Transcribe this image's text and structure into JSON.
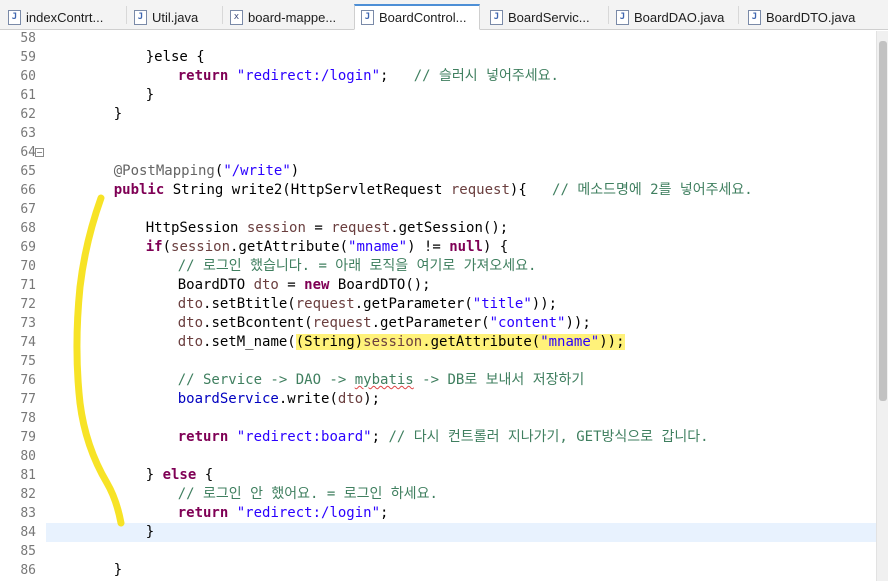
{
  "tabs": [
    {
      "label": "indexContrt...",
      "icon": "java-file-icon"
    },
    {
      "label": "Util.java",
      "icon": "java-file-icon"
    },
    {
      "label": "board-mappe...",
      "icon": "xml-file-icon"
    },
    {
      "label": "BoardControl...",
      "icon": "java-file-icon",
      "active": true
    },
    {
      "label": "BoardServic...",
      "icon": "java-file-icon"
    },
    {
      "label": "BoardDAO.java",
      "icon": "java-file-icon"
    },
    {
      "label": "BoardDTO.java",
      "icon": "java-file-icon"
    }
  ],
  "gutter": {
    "line_numbers": [
      "58",
      "59",
      "60",
      "61",
      "62",
      "63",
      "64",
      "65",
      "66",
      "67",
      "68",
      "69",
      "70",
      "71",
      "72",
      "73",
      "74",
      "75",
      "76",
      "77",
      "78",
      "79",
      "80",
      "81",
      "82",
      "83",
      "84",
      "85",
      "86"
    ],
    "fold_marker": "−"
  },
  "code": {
    "l58": {
      "t1": "}else {"
    },
    "l59": {
      "t1": "return",
      "t2": " ",
      "t3": "\"redirect:/login\"",
      "t4": ";   ",
      "t5": "// 슬러시 넣어주세요."
    },
    "l60": {
      "t1": "}"
    },
    "l61": {
      "t1": "}"
    },
    "l64": {
      "t1": "@PostMapping",
      "t2": "(",
      "t3": "\"/write\"",
      "t4": ")"
    },
    "l65": {
      "t1": "public",
      "t2": " String write2(HttpServletRequest ",
      "t3": "request",
      "t4": "){   ",
      "t5": "// 메소드명에 2를 넣어주세요."
    },
    "l67": {
      "t1": "HttpSession ",
      "t2": "session",
      "t3": " = ",
      "t4": "request",
      "t5": ".getSession();"
    },
    "l68": {
      "t1": "if",
      "t2": "(",
      "t3": "session",
      "t4": ".getAttribute(",
      "t5": "\"mname\"",
      "t6": ") != ",
      "t7": "null",
      "t8": ") {"
    },
    "l69": {
      "t1": "// 로그인 했습니다. = 아래 로직을 여기로 가져오세요."
    },
    "l70": {
      "t1": "BoardDTO ",
      "t2": "dto",
      "t3": " = ",
      "t4": "new",
      "t5": " BoardDTO();"
    },
    "l71": {
      "t1": "dto",
      "t2": ".setBtitle(",
      "t3": "request",
      "t4": ".getParameter(",
      "t5": "\"title\"",
      "t6": "));"
    },
    "l72": {
      "t1": "dto",
      "t2": ".setBcontent(",
      "t3": "request",
      "t4": ".getParameter(",
      "t5": "\"content\"",
      "t6": "));"
    },
    "l73": {
      "t1": "dto",
      "t2": ".setM_name(",
      "t3": "(String)",
      "t4": "session",
      "t5": ".getAttribute(",
      "t6": "\"mname\"",
      "t7": "));"
    },
    "l75": {
      "t1": "// Service -> DAO -> ",
      "t2": "mybatis",
      "t3": " -> DB로 보내서 저장하기"
    },
    "l76": {
      "t1": "boardService",
      "t2": ".write(",
      "t3": "dto",
      "t4": ");"
    },
    "l78": {
      "t1": "return",
      "t2": " ",
      "t3": "\"redirect:board\"",
      "t4": "; ",
      "t5": "// 다시 컨트롤러 지나가기, GET방식으로 갑니다."
    },
    "l80": {
      "t1": "} ",
      "t2": "else",
      "t3": " {"
    },
    "l81": {
      "t1": "// 로그인 안 했어요. = 로그인 하세요."
    },
    "l82": {
      "t1": "return",
      "t2": " ",
      "t3": "\"redirect:/login\"",
      "t4": ";"
    },
    "l83": {
      "t1": "}"
    },
    "l85": {
      "t1": "}"
    }
  },
  "colors": {
    "keyword": "#7f0055",
    "string": "#2a00ff",
    "comment": "#3f7f5f",
    "annotation": "#646464",
    "local_variable": "#6a3e3e",
    "field": "#0000c0",
    "highlight": "#fff27a",
    "marker_stroke": "#f7e11a",
    "current_line": "#e8f2fe"
  }
}
